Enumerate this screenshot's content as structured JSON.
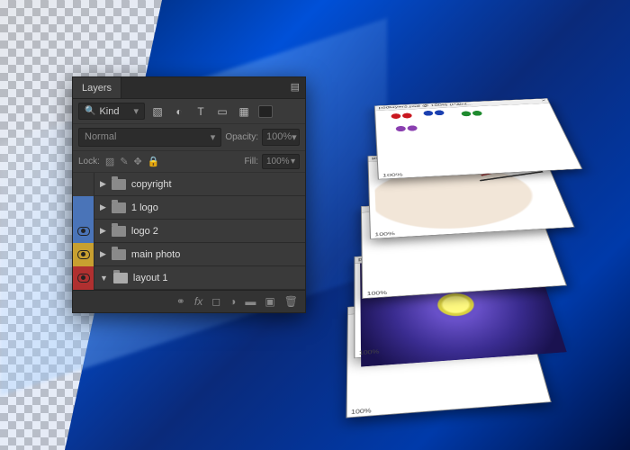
{
  "panel": {
    "tab_label": "Layers",
    "kind_label": "Kind",
    "blend_mode": "Normal",
    "opacity_label": "Opacity:",
    "opacity_value": "100%",
    "lock_label": "Lock:",
    "fill_label": "Fill:",
    "fill_value": "100%",
    "layers": [
      {
        "name": "copyright"
      },
      {
        "name": "1 logo"
      },
      {
        "name": "logo 2"
      },
      {
        "name": "main photo"
      },
      {
        "name": "layout 1"
      }
    ]
  },
  "stack": {
    "title_frag": "psdlayers.psd @ 100% (Paint...",
    "title_frag2": "psdlayers.psd @ 1007...",
    "zoom": "100%"
  }
}
